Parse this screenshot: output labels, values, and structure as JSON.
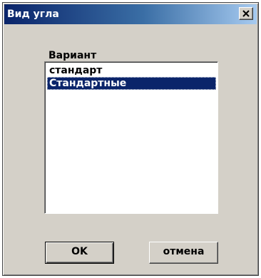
{
  "window": {
    "title": "Вид угла",
    "close_icon": "close-x-icon"
  },
  "variant_group": {
    "label": "Вариант",
    "items": [
      {
        "label": "стандарт",
        "selected": false
      },
      {
        "label": "Стандартные",
        "selected": true
      }
    ]
  },
  "buttons": {
    "ok_label": "OK",
    "cancel_label": "отмена"
  },
  "colors": {
    "titlebar_start": "#0a246a",
    "titlebar_end": "#a6caf0",
    "selection": "#0a246a",
    "dialog_face": "#d4d0c8"
  }
}
